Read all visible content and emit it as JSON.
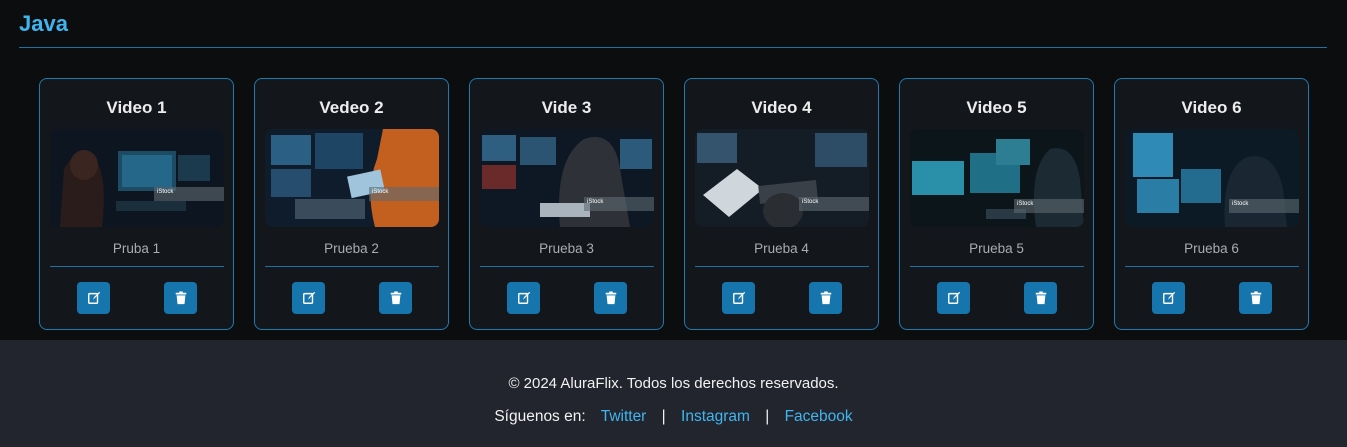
{
  "section": {
    "title": "Java"
  },
  "videos": [
    {
      "title": "Video 1",
      "description": "Pruba 1"
    },
    {
      "title": "Vedeo 2",
      "description": "Prueba 2"
    },
    {
      "title": "Vide 3",
      "description": "Prueba 3"
    },
    {
      "title": "Video 4",
      "description": "Prueba 4"
    },
    {
      "title": "Video 5",
      "description": "Prueba 5"
    },
    {
      "title": "Video 6",
      "description": "Prueba 6"
    }
  ],
  "thumbnail_watermark": "iStock",
  "icons": {
    "edit": "edit-icon",
    "delete": "trash-icon"
  },
  "colors": {
    "accent": "#3fb5ef",
    "button": "#1675ad",
    "border": "#1f7ab0"
  },
  "footer": {
    "copyright": "© 2024 AluraFlix. Todos los derechos reservados.",
    "follow_label": "Síguenos en:",
    "separator": "|",
    "links": [
      "Twitter",
      "Instagram",
      "Facebook"
    ]
  }
}
